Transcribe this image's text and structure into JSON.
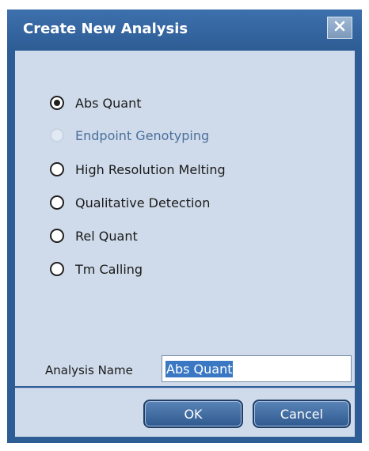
{
  "dialog": {
    "title": "Create New Analysis",
    "close_icon": "close-icon"
  },
  "analysis_types": [
    {
      "label": "Abs Quant",
      "selected": true,
      "enabled": true
    },
    {
      "label": "Endpoint Genotyping",
      "selected": false,
      "enabled": false
    },
    {
      "label": "High Resolution Melting",
      "selected": false,
      "enabled": true
    },
    {
      "label": "Qualitative Detection",
      "selected": false,
      "enabled": true
    },
    {
      "label": "Rel Quant",
      "selected": false,
      "enabled": true
    },
    {
      "label": "Tm Calling",
      "selected": false,
      "enabled": true
    }
  ],
  "analysis_name": {
    "label": "Analysis Name",
    "value": "Abs Quant"
  },
  "buttons": {
    "ok": "OK",
    "cancel": "Cancel"
  },
  "colors": {
    "title_bar": "#2e5d95",
    "panel": "#cfdbea",
    "selection": "#3b78c4"
  }
}
